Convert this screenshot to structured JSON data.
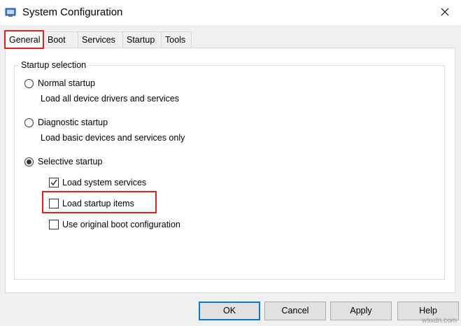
{
  "window": {
    "title": "System Configuration"
  },
  "tabs": [
    {
      "label": "General",
      "active": true
    },
    {
      "label": "Boot"
    },
    {
      "label": "Services"
    },
    {
      "label": "Startup"
    },
    {
      "label": "Tools"
    }
  ],
  "startup_selection": {
    "label": "Startup selection",
    "normal": {
      "label": "Normal startup",
      "description": "Load all device drivers and services",
      "selected": false
    },
    "diagnostic": {
      "label": "Diagnostic startup",
      "description": "Load basic devices and services only",
      "selected": false
    },
    "selective": {
      "label": "Selective startup",
      "selected": true,
      "options": [
        {
          "label": "Load system services",
          "checked": true
        },
        {
          "label": "Load startup items",
          "checked": false,
          "highlighted": true
        },
        {
          "label": "Use original boot configuration",
          "checked": false
        }
      ]
    }
  },
  "buttons": {
    "ok": "OK",
    "cancel": "Cancel",
    "apply": "Apply",
    "help": "Help"
  },
  "watermark": "wsxdn.com",
  "colors": {
    "highlight": "#dd2222",
    "focus": "#0078d7"
  }
}
